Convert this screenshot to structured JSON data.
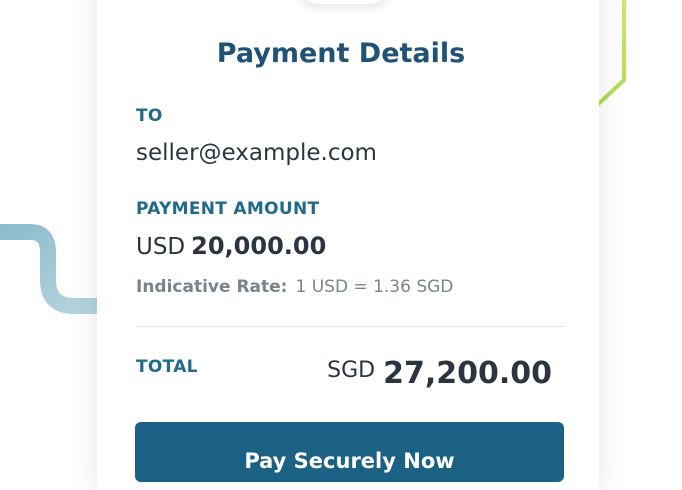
{
  "payment": {
    "title": "Payment Details",
    "to_label": "TO",
    "to_value": "seller@example.com",
    "amount_label": "PAYMENT AMOUNT",
    "amount_currency": "USD",
    "amount_value": "20,000.00",
    "rate_label": "Indicative Rate:",
    "rate_value": "1 USD = 1.36 SGD",
    "total_label": "TOTAL",
    "total_currency": "SGD",
    "total_value": "27,200.00",
    "pay_button_label": "Pay Securely Now"
  },
  "colors": {
    "primary": "#1b6183",
    "heading": "#1f5275",
    "label": "#1f6b88",
    "accent_green": "#b4e14a",
    "deco_teal": "#7fb1c4"
  }
}
